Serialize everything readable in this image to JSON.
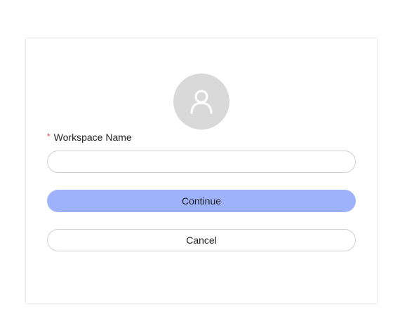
{
  "form": {
    "avatar_icon": "user-icon",
    "required_mark": "*",
    "workspace_name_label": "Workspace Name",
    "workspace_name_value": "",
    "workspace_name_placeholder": ""
  },
  "buttons": {
    "continue_label": "Continue",
    "cancel_label": "Cancel"
  },
  "colors": {
    "primary_button": "#9db2fb",
    "required_mark": "#e5484d",
    "avatar_background": "#d9d9d9"
  }
}
